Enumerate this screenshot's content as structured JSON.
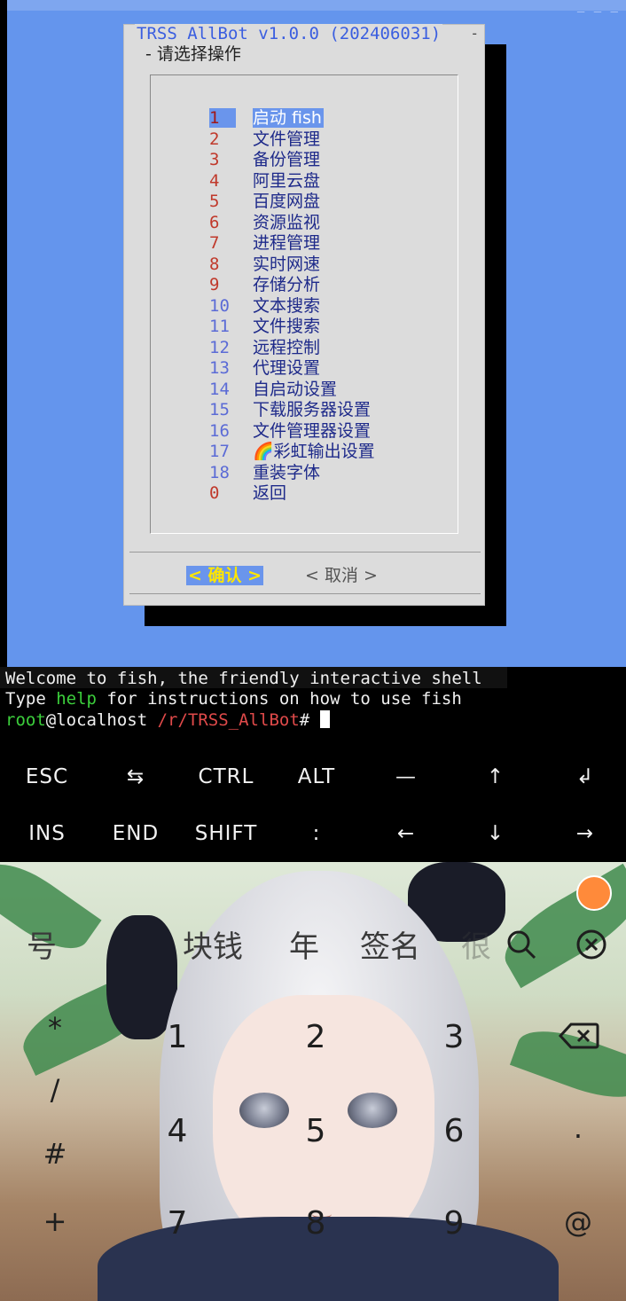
{
  "terminal_bg_text": "_ _ _",
  "dialog": {
    "title": "TRSS AllBot v1.0.0 (202406031)",
    "title_dash": "-",
    "subtitle": "- 请选择操作",
    "items": [
      {
        "num": "1",
        "label": "启动 fish",
        "selected": true
      },
      {
        "num": "2",
        "label": "文件管理"
      },
      {
        "num": "3",
        "label": "备份管理"
      },
      {
        "num": "4",
        "label": "阿里云盘"
      },
      {
        "num": "5",
        "label": "百度网盘"
      },
      {
        "num": "6",
        "label": "资源监视"
      },
      {
        "num": "7",
        "label": "进程管理"
      },
      {
        "num": "8",
        "label": "实时网速"
      },
      {
        "num": "9",
        "label": "存储分析"
      },
      {
        "num": "10",
        "label": "文本搜索"
      },
      {
        "num": "11",
        "label": "文件搜索"
      },
      {
        "num": "12",
        "label": "远程控制"
      },
      {
        "num": "13",
        "label": "代理设置"
      },
      {
        "num": "14",
        "label": "自启动设置"
      },
      {
        "num": "15",
        "label": "下载服务器设置"
      },
      {
        "num": "16",
        "label": "文件管理器设置"
      },
      {
        "num": "17",
        "label": "🌈彩虹输出设置"
      },
      {
        "num": "18",
        "label": "重装字体"
      },
      {
        "num": "0",
        "label": "返回"
      }
    ],
    "ok_label": "< 确认 >",
    "cancel_label": "< 取消 >"
  },
  "terminal": {
    "line1": "Welcome to fish, the friendly interactive shell",
    "line2_a": "Type ",
    "line2_help": "help",
    "line2_b": " for instructions on how to use fish",
    "prompt_user": "root",
    "prompt_host": "@localhost ",
    "prompt_path": "/r/TRSS_AllBot",
    "prompt_hash": "# "
  },
  "extra_keys": {
    "row1": [
      "ESC",
      "⇆",
      "CTRL",
      "ALT",
      "—",
      "↑",
      "↲"
    ],
    "row2": [
      "INS",
      "END",
      "SHIFT",
      ":",
      "←",
      "↓",
      "→"
    ]
  },
  "keyboard": {
    "candidates": [
      "号",
      "块钱",
      "年",
      "签名",
      "很"
    ],
    "symbols": [
      "*",
      "/",
      "#",
      "+"
    ],
    "digits": [
      "1",
      "2",
      "3",
      "4",
      "5",
      "6",
      "7",
      "8",
      "9"
    ],
    "right_keys": [
      ".",
      "@"
    ],
    "icons": [
      "search-icon",
      "close-icon",
      "backspace-icon"
    ]
  }
}
